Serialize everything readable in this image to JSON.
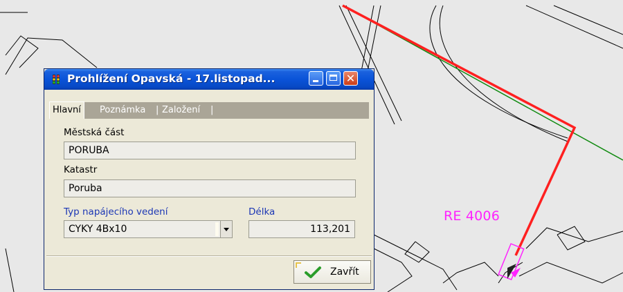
{
  "map": {
    "label": "RE 4006",
    "label_color": "#ff22ff",
    "background_color": "#e8e8e8",
    "cable_color": "#ff2020",
    "line_color": "#108a10"
  },
  "dialog": {
    "title": "Prohlížení Opavská - 17.listopad...",
    "buttons": {
      "minimize": "minimize",
      "maximize": "maximize",
      "close": "✕"
    },
    "tabs": [
      {
        "label": "Hlavní",
        "active": true
      },
      {
        "label": "Poznámka",
        "active": false
      },
      {
        "label": "Založení",
        "active": false
      }
    ],
    "tab_separator": "|",
    "fields": {
      "mestska_cast": {
        "label": "Městská část",
        "value": "PORUBA"
      },
      "katastr": {
        "label": "Katastr",
        "value": "Poruba"
      },
      "typ": {
        "label": "Typ napájecího vedení",
        "value": "CYKY 4Bx10"
      },
      "delka": {
        "label": "Délka",
        "value": "113,201"
      }
    },
    "close_button": {
      "label": "Zavřít",
      "icon": "check-icon"
    }
  }
}
